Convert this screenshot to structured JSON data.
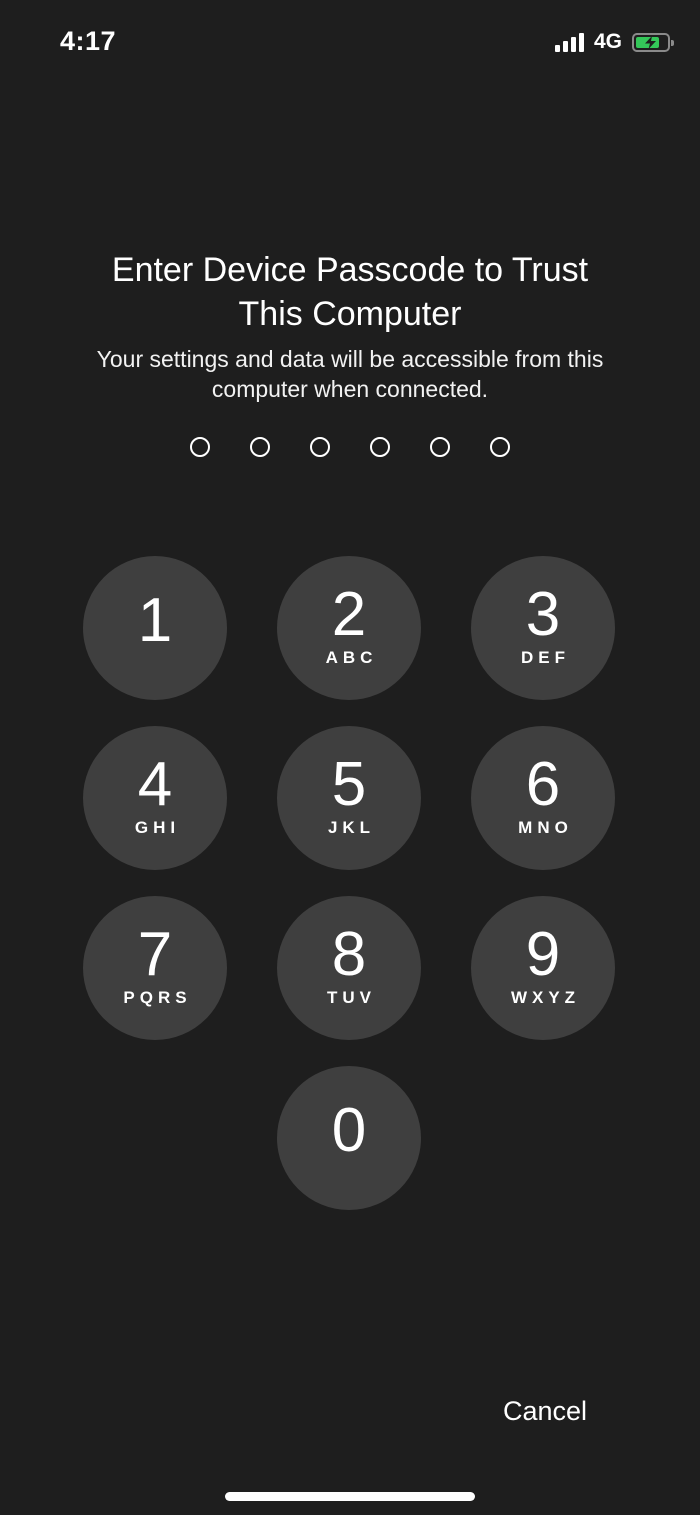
{
  "status_bar": {
    "time": "4:17",
    "network": "4G",
    "signal_icon": "cellular-signal-icon",
    "battery_icon": "battery-charging-icon",
    "battery_level": 0.75,
    "battery_color": "#34c759"
  },
  "prompt": {
    "title_line1": "Enter Device Passcode to Trust",
    "title_line2": "This Computer",
    "subtitle_line1": "Your settings and data will be accessible from this",
    "subtitle_line2": "computer when connected.",
    "passcode_length": 6,
    "entered_digits": 0
  },
  "keypad": {
    "keys": [
      {
        "digit": "1",
        "letters": ""
      },
      {
        "digit": "2",
        "letters": "ABC"
      },
      {
        "digit": "3",
        "letters": "DEF"
      },
      {
        "digit": "4",
        "letters": "GHI"
      },
      {
        "digit": "5",
        "letters": "JKL"
      },
      {
        "digit": "6",
        "letters": "MNO"
      },
      {
        "digit": "7",
        "letters": "PQRS"
      },
      {
        "digit": "8",
        "letters": "TUV"
      },
      {
        "digit": "9",
        "letters": "WXYZ"
      },
      {
        "digit": "0",
        "letters": ""
      }
    ]
  },
  "actions": {
    "cancel_label": "Cancel"
  },
  "colors": {
    "background": "#1e1e1e",
    "key_background": "#3f3f3f"
  }
}
